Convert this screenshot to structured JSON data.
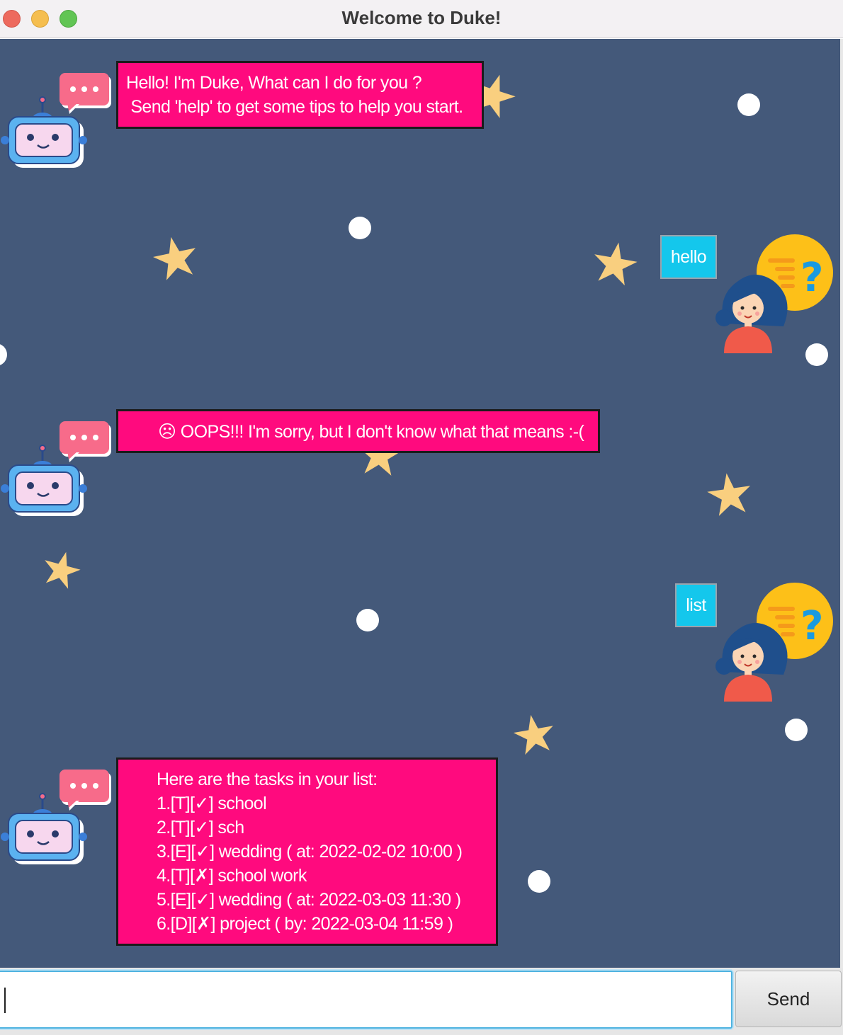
{
  "window": {
    "title": "Welcome to Duke!"
  },
  "messages": [
    {
      "from": "bot",
      "lines": [
        "Hello! I'm Duke, What can I do for you ?",
        " Send 'help' to get some tips to help you start."
      ]
    },
    {
      "from": "user",
      "text": "hello"
    },
    {
      "from": "bot",
      "lines": [
        "☹ OOPS!!! I'm sorry, but I don't know what that means :-("
      ]
    },
    {
      "from": "user",
      "text": "list"
    },
    {
      "from": "bot",
      "lines": [
        "Here are the tasks in your list:",
        "1.[T][✓] school",
        "2.[T][✓] sch",
        "3.[E][✓] wedding ( at: 2022-02-02 10:00 )",
        "4.[T][✗] school work",
        "5.[E][✓] wedding ( at: 2022-03-03 11:30 )",
        "6.[D][✗] project ( by: 2022-03-04 11:59 )"
      ]
    }
  ],
  "input": {
    "value": "",
    "send_label": "Send"
  },
  "icons": {
    "bot_avatar": "robot-icon",
    "user_avatar": "user-question-icon",
    "background": "star-icon"
  },
  "colors": {
    "chat_background": "#44597a",
    "bot_bubble": "#ff0a7e",
    "user_bubble": "#14c7ec"
  }
}
